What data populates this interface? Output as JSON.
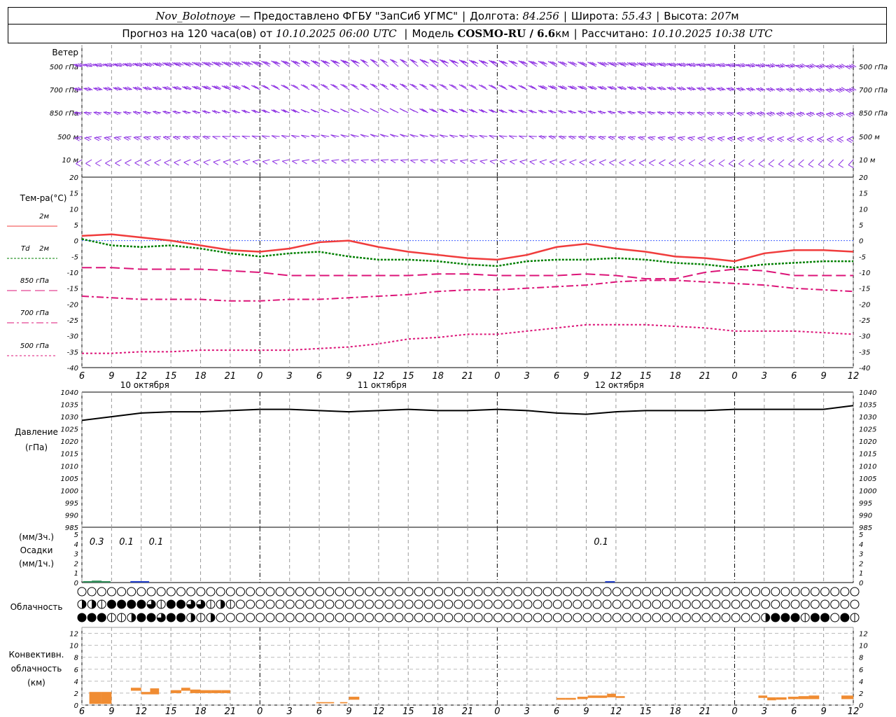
{
  "header": {
    "station": "Nov_Bolotnoye",
    "provided": "— Предоставлено ФГБУ \"ЗапСиб УГМС\"",
    "lon_label": "Долгота:",
    "lon_value": "84.256",
    "lat_label": "Широта:",
    "lat_value": "55.43",
    "alt_label": "Высота:",
    "alt_value": "207",
    "alt_unit": "м",
    "forecast_prefix": "Прогноз на 120 часа(ов) от",
    "forecast_time": "10.10.2025 06:00 UTC",
    "model_label": "Модель",
    "model_value": "COSMO-RU / 6.6",
    "model_unit": "км",
    "computed_label": "Рассчитано:",
    "computed_value": "10.10.2025 10:38 UTC"
  },
  "labels": {
    "wind": "Ветер",
    "wind_levels": [
      "500 гПа",
      "700 гПа",
      "850 гПа",
      "500 м",
      "10 м"
    ],
    "temp": "Тем-ра(°С)",
    "t2m": "2м",
    "td_prefix": "Td",
    "td2m": "2м",
    "t850": "850 гПа",
    "t700": "700 гПа",
    "t500": "500 гПа",
    "pressure": "Давление",
    "pressure_unit": "(гПа)",
    "precip_unit3": "(мм/3ч.)",
    "precip": "Осадки",
    "precip_unit1": "(мм/1ч.)",
    "cloud": "Облачность",
    "conv1": "Конвективн.",
    "conv2": "облачность",
    "conv3": "(км)"
  },
  "colors": {
    "wind": "#8a2be2",
    "t2m": "#f03c3c",
    "td": "#008000",
    "t850": "#dc1478",
    "t700": "#dc1478",
    "t500": "#dc1478",
    "pressure": "#000000",
    "conv": "#f08c32",
    "zero_line": "#4060ff",
    "grid": "#999999"
  },
  "chart_data": {
    "type": "line",
    "x_start": "10.10.2025 06:00 UTC",
    "x_hours": [
      6,
      9,
      12,
      15,
      18,
      21,
      0,
      3,
      6,
      9,
      12,
      15,
      18,
      21,
      0,
      3,
      6,
      9,
      12,
      15,
      18,
      21,
      0,
      3,
      6,
      9,
      12
    ],
    "day_labels": [
      "10 октября",
      "11 октября",
      "12 октября"
    ],
    "temperature": {
      "ylim": [
        -40,
        20
      ],
      "yticks": [
        20,
        15,
        10,
        5,
        0,
        -5,
        -10,
        -15,
        -20,
        -25,
        -30,
        -35,
        -40
      ],
      "series": [
        {
          "name": "2м",
          "values": [
            1.5,
            2,
            1,
            0,
            -1.5,
            -3,
            -3.5,
            -2.5,
            -0.5,
            0,
            -2,
            -3.5,
            -4.5,
            -5.5,
            -6,
            -4.5,
            -2,
            -1,
            -2.5,
            -3.5,
            -5,
            -5.5,
            -6.5,
            -4,
            -3,
            -3,
            -3.5
          ]
        },
        {
          "name": "Td 2м",
          "values": [
            0.5,
            -1.5,
            -2,
            -1.5,
            -2.5,
            -4,
            -5,
            -4,
            -3.5,
            -5,
            -6,
            -6,
            -6.5,
            -7.5,
            -8,
            -6.5,
            -6,
            -6,
            -5.5,
            -6,
            -7,
            -7.5,
            -8.5,
            -7.5,
            -7,
            -6.5,
            -6.5
          ]
        },
        {
          "name": "850 гПа",
          "values": [
            -8.5,
            -8.5,
            -9,
            -9,
            -9,
            -9.5,
            -10,
            -11,
            -11,
            -11,
            -11,
            -11,
            -10.5,
            -10.5,
            -11,
            -11,
            -11,
            -10.5,
            -11,
            -12,
            -12,
            -10,
            -9,
            -9.5,
            -11,
            -11,
            -11
          ]
        },
        {
          "name": "700 гПа",
          "values": [
            -17.5,
            -18,
            -18.5,
            -18.5,
            -18.5,
            -19,
            -19,
            -18.5,
            -18.5,
            -18,
            -17.5,
            -17,
            -16,
            -15.5,
            -15.5,
            -15,
            -14.5,
            -14,
            -13,
            -12.5,
            -12.5,
            -13,
            -13.5,
            -14,
            -15,
            -15.5,
            -16
          ]
        },
        {
          "name": "500 гПа",
          "values": [
            -35.5,
            -35.5,
            -35,
            -35,
            -34.5,
            -34.5,
            -34.5,
            -34.5,
            -34,
            -33.5,
            -32.5,
            -31,
            -30.5,
            -29.5,
            -29.5,
            -28.5,
            -27.5,
            -26.5,
            -26.5,
            -26.5,
            -27,
            -27.5,
            -28.5,
            -28.5,
            -28.5,
            -29,
            -29.5
          ]
        }
      ]
    },
    "pressure": {
      "ylim": [
        985,
        1040
      ],
      "yticks": [
        1040,
        1035,
        1030,
        1025,
        1020,
        1015,
        1010,
        1005,
        1000,
        995,
        990,
        985
      ],
      "values": [
        1028.5,
        1030,
        1031.5,
        1032,
        1032,
        1032.5,
        1033,
        1033,
        1032.5,
        1032,
        1032.5,
        1033,
        1032.5,
        1032.5,
        1033,
        1032.5,
        1031.5,
        1031,
        1032,
        1032.5,
        1032.5,
        1032.5,
        1033,
        1033,
        1033,
        1033,
        1034.5
      ]
    },
    "precipitation": {
      "ylim": [
        0,
        5
      ],
      "yticks": [
        5,
        4,
        3,
        2,
        1,
        0
      ],
      "labels": [
        {
          "time_index": 0.5,
          "text": "0.3"
        },
        {
          "time_index": 1.5,
          "text": "0.1"
        },
        {
          "time_index": 2.5,
          "text": "0.1"
        },
        {
          "time_index": 17.5,
          "text": "0.1"
        }
      ],
      "bars": [
        {
          "time_index": 0.2,
          "value": 0.15,
          "kind": "3h"
        },
        {
          "time_index": 0.5,
          "value": 0.2,
          "kind": "3h"
        },
        {
          "time_index": 0.8,
          "value": 0.1,
          "kind": "3h"
        },
        {
          "time_index": 1.8,
          "value": 0.15,
          "kind": "1h"
        },
        {
          "time_index": 2.1,
          "value": 0.08,
          "kind": "1h"
        },
        {
          "time_index": 17.8,
          "value": 0.05,
          "kind": "1h"
        }
      ]
    },
    "cloud_rows": [
      "0000000000000000000000000000000000000000000000000000000000000000000000000000000",
      "2214444314433121000000000000000000000000000000000000000000000000000000000000000",
      "4441124434421200000000000000000000000000000000000000000000000000000002444144041044200000000000000000000000000"
    ],
    "convective": {
      "ylim": [
        0,
        13
      ],
      "yticks": [
        12,
        10,
        8,
        6,
        4,
        2,
        0
      ],
      "bars": [
        {
          "t": 0.25,
          "w": 0.4,
          "base": 0.2,
          "top": 2.2
        },
        {
          "t": 0.65,
          "w": 0.35,
          "base": 0.2,
          "top": 2.2
        },
        {
          "t": 1.65,
          "w": 0.35,
          "base": 2.4,
          "top": 2.9
        },
        {
          "t": 2.0,
          "w": 0.3,
          "base": 1.8,
          "top": 2.2
        },
        {
          "t": 2.3,
          "w": 0.3,
          "base": 1.8,
          "top": 2.8
        },
        {
          "t": 3.0,
          "w": 0.35,
          "base": 2.0,
          "top": 2.5
        },
        {
          "t": 3.35,
          "w": 0.3,
          "base": 2.4,
          "top": 2.9
        },
        {
          "t": 3.65,
          "w": 0.35,
          "base": 2.0,
          "top": 2.6
        },
        {
          "t": 4.0,
          "w": 0.35,
          "base": 2.0,
          "top": 2.5
        },
        {
          "t": 4.35,
          "w": 0.35,
          "base": 2.0,
          "top": 2.5
        },
        {
          "t": 4.7,
          "w": 0.3,
          "base": 2.0,
          "top": 2.5
        },
        {
          "t": 7.9,
          "w": 0.3,
          "base": 0.3,
          "top": 0.5
        },
        {
          "t": 8.2,
          "w": 0.3,
          "base": 0.3,
          "top": 0.5
        },
        {
          "t": 8.7,
          "w": 0.25,
          "base": 0.3,
          "top": 0.5
        },
        {
          "t": 9.0,
          "w": 0.35,
          "base": 0.9,
          "top": 1.4
        },
        {
          "t": 16.0,
          "w": 0.3,
          "base": 0.9,
          "top": 1.2
        },
        {
          "t": 16.3,
          "w": 0.35,
          "base": 0.9,
          "top": 1.2
        },
        {
          "t": 16.7,
          "w": 0.35,
          "base": 1.0,
          "top": 1.4
        },
        {
          "t": 17.05,
          "w": 0.35,
          "base": 1.2,
          "top": 1.6
        },
        {
          "t": 17.4,
          "w": 0.3,
          "base": 1.2,
          "top": 1.6
        },
        {
          "t": 17.7,
          "w": 0.3,
          "base": 1.3,
          "top": 1.9
        },
        {
          "t": 18.0,
          "w": 0.3,
          "base": 1.2,
          "top": 1.5
        },
        {
          "t": 22.8,
          "w": 0.3,
          "base": 1.2,
          "top": 1.6
        },
        {
          "t": 23.1,
          "w": 0.3,
          "base": 0.8,
          "top": 1.3
        },
        {
          "t": 23.4,
          "w": 0.35,
          "base": 0.9,
          "top": 1.3
        },
        {
          "t": 23.8,
          "w": 0.35,
          "base": 1.0,
          "top": 1.4
        },
        {
          "t": 24.15,
          "w": 0.35,
          "base": 1.0,
          "top": 1.5
        },
        {
          "t": 24.5,
          "w": 0.35,
          "base": 1.0,
          "top": 1.6
        },
        {
          "t": 25.6,
          "w": 0.4,
          "base": 1.0,
          "top": 1.6
        }
      ]
    },
    "wind": {
      "levels": [
        "500 гПа",
        "700 гПа",
        "850 гПа",
        "500 м",
        "10 м"
      ],
      "direction_deg": [
        [
          260,
          262,
          265,
          268,
          270,
          272,
          275,
          278,
          280,
          282,
          285,
          285,
          285,
          282,
          280,
          278,
          275,
          272,
          270,
          268,
          265,
          262,
          260,
          258,
          255,
          252,
          250
        ],
        [
          255,
          258,
          260,
          262,
          265,
          268,
          270,
          272,
          275,
          276,
          278,
          278,
          276,
          274,
          272,
          270,
          268,
          266,
          264,
          262,
          260,
          258,
          256,
          254,
          252,
          250,
          248
        ],
        [
          250,
          252,
          254,
          256,
          258,
          260,
          262,
          264,
          266,
          268,
          270,
          270,
          268,
          266,
          264,
          262,
          260,
          258,
          256,
          254,
          252,
          250,
          248,
          246,
          244,
          242,
          240
        ],
        [
          240,
          242,
          244,
          246,
          248,
          250,
          252,
          254,
          256,
          258,
          260,
          260,
          258,
          256,
          254,
          252,
          250,
          248,
          246,
          244,
          242,
          240,
          238,
          236,
          234,
          232,
          230
        ],
        [
          225,
          228,
          230,
          232,
          234,
          236,
          238,
          240,
          242,
          244,
          246,
          246,
          244,
          242,
          240,
          238,
          236,
          234,
          232,
          230,
          228,
          226,
          224,
          222,
          220,
          218,
          215
        ]
      ],
      "speed_ms": [
        [
          22,
          24,
          25,
          24,
          22,
          20,
          18,
          16,
          14,
          13,
          12,
          12,
          13,
          14,
          15,
          16,
          16,
          17,
          18,
          19,
          20,
          21,
          22,
          23,
          24,
          25,
          26
        ],
        [
          14,
          15,
          16,
          15,
          14,
          13,
          12,
          11,
          10,
          9,
          9,
          9,
          10,
          11,
          12,
          12,
          13,
          13,
          14,
          14,
          15,
          15,
          16,
          16,
          17,
          17,
          18
        ],
        [
          10,
          11,
          12,
          11,
          10,
          9,
          8,
          8,
          7,
          7,
          7,
          7,
          8,
          8,
          9,
          9,
          10,
          10,
          11,
          11,
          12,
          12,
          12,
          13,
          13,
          13,
          14
        ],
        [
          8,
          9,
          10,
          9,
          8,
          7,
          7,
          6,
          6,
          5,
          5,
          5,
          6,
          6,
          7,
          7,
          8,
          8,
          9,
          9,
          9,
          10,
          10,
          10,
          11,
          11,
          12
        ],
        [
          4,
          5,
          5,
          5,
          4,
          4,
          3,
          3,
          3,
          3,
          3,
          3,
          3,
          3,
          4,
          4,
          4,
          4,
          5,
          5,
          5,
          5,
          6,
          6,
          6,
          6,
          6
        ]
      ]
    }
  }
}
